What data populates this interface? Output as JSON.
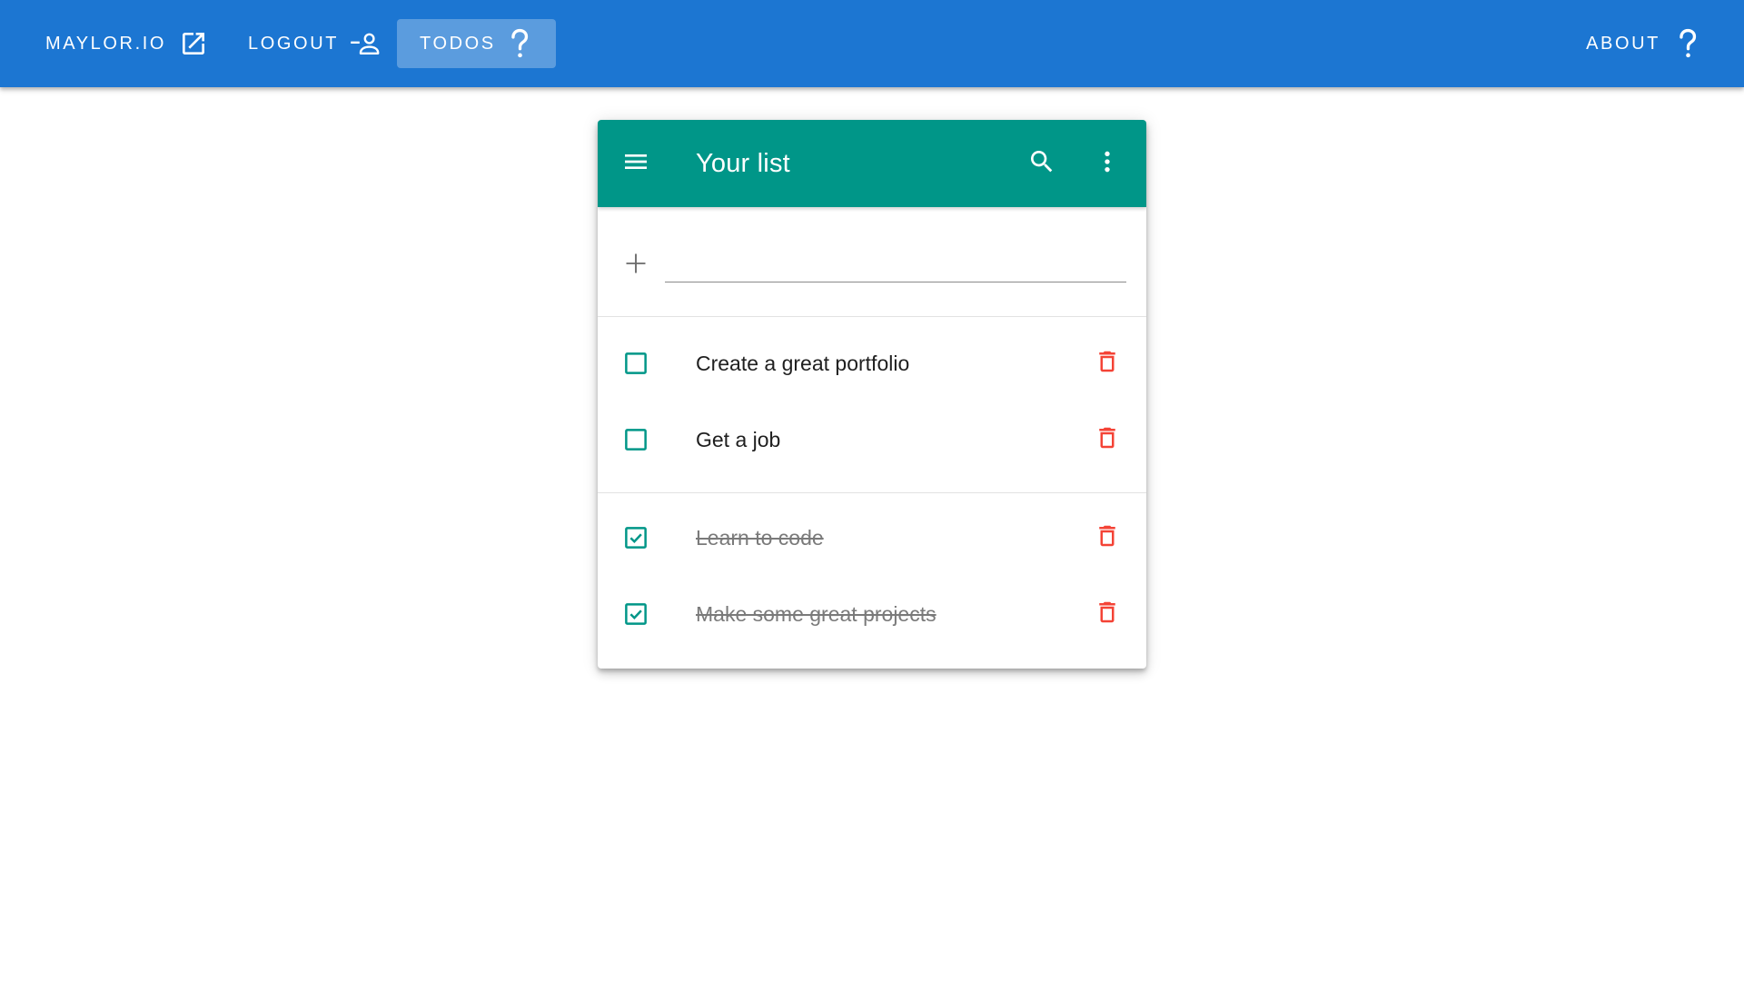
{
  "navbar": {
    "background": "#1c76d2",
    "items": [
      {
        "label": "MAYLOR.IO",
        "icon": "open-in-new-icon"
      },
      {
        "label": "LOGOUT",
        "icon": "person-remove-icon"
      },
      {
        "label": "TODOS",
        "icon": "question-mark-icon",
        "active": true
      },
      {
        "label": "ABOUT",
        "icon": "question-mark-icon"
      }
    ]
  },
  "card": {
    "toolbar_color": "#009688",
    "title": "Your list",
    "menu_icon": "menu-icon",
    "search_icon": "search-icon",
    "more_icon": "more-vert-icon"
  },
  "add_todo": {
    "icon": "plus-icon",
    "value": "",
    "placeholder": ""
  },
  "todos": {
    "pending": [
      {
        "text": "Create a great portfolio",
        "checked": false
      },
      {
        "text": "Get a job",
        "checked": false
      }
    ],
    "completed": [
      {
        "text": "Learn to code",
        "checked": true
      },
      {
        "text": "Make some great projects",
        "checked": true
      }
    ],
    "check_color": "#009688",
    "delete_icon": "trash-icon",
    "delete_color": "#f44336"
  }
}
